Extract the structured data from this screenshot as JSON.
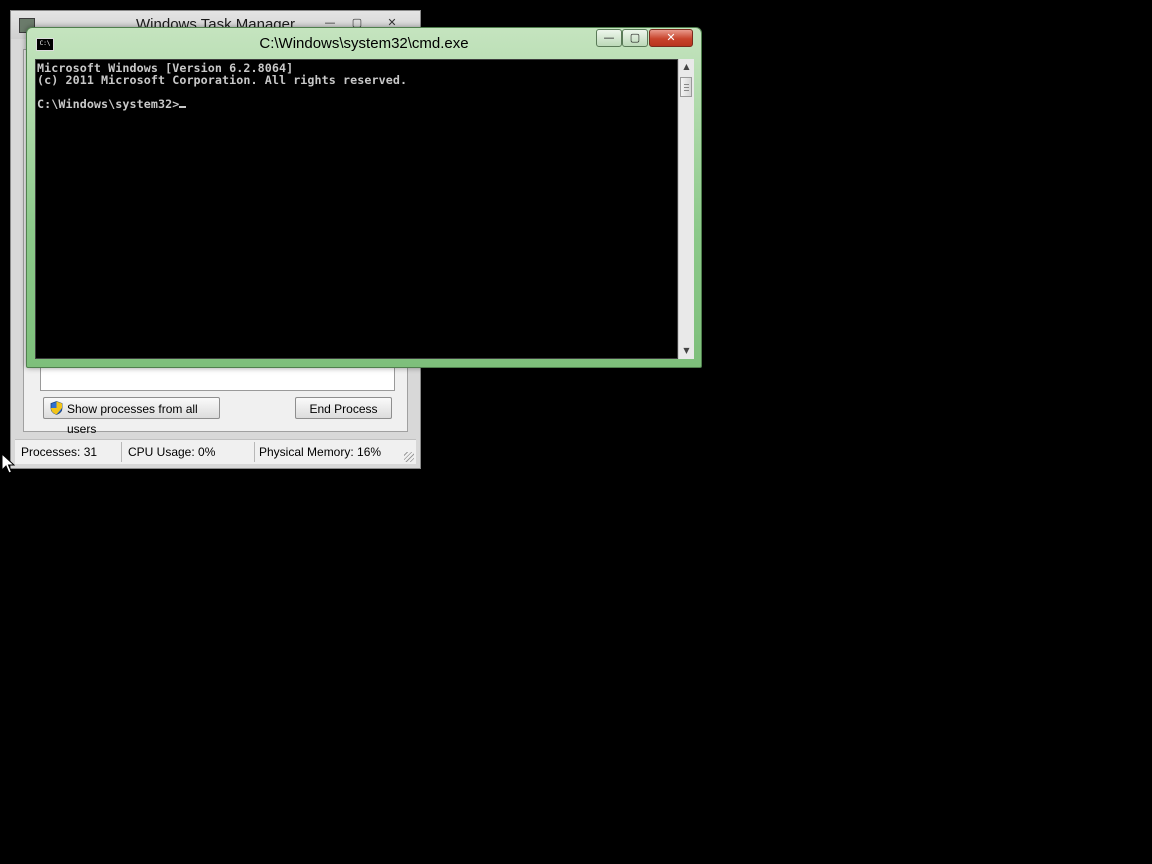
{
  "task_manager": {
    "title": "Windows Task Manager",
    "buttons": {
      "minimize": "—",
      "maximize": "▢",
      "close": "✕"
    },
    "show_all_button": "Show processes from all users",
    "end_process_button": "End Process",
    "status": {
      "processes": "Processes: 31",
      "cpu": "CPU Usage: 0%",
      "memory": "Physical Memory: 16%"
    }
  },
  "cmd": {
    "title": "C:\\Windows\\system32\\cmd.exe",
    "icon_text": "C:\\",
    "buttons": {
      "minimize": "—",
      "maximize": "▢",
      "close": "✕"
    },
    "lines": [
      "Microsoft Windows [Version 6.2.8064]",
      "(c) 2011 Microsoft Corporation. All rights reserved.",
      "",
      "C:\\Windows\\system32>"
    ],
    "scroll_up": "▲",
    "scroll_down": "▼"
  },
  "colors": {
    "desktop": "#000000",
    "cmd_frame": "#8cc98a",
    "close_button": "#c8442c",
    "console_bg": "#000000",
    "console_text": "#c8c8c8"
  }
}
